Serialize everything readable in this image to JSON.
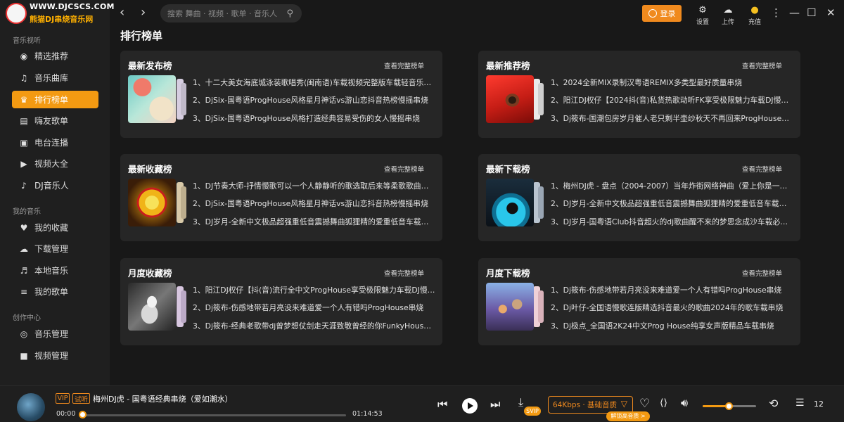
{
  "app": {
    "url": "WWW.DJCSCS.COM",
    "brand": "熊猫DJ串烧音乐网"
  },
  "sidebar": {
    "sections": [
      {
        "title": "音乐视听",
        "items": [
          {
            "label": "精选推荐",
            "icon": "recommend-icon"
          },
          {
            "label": "音乐曲库",
            "icon": "music-note-icon"
          },
          {
            "label": "排行榜单",
            "icon": "medal-icon",
            "active": true
          },
          {
            "label": "嗨友歌单",
            "icon": "playlist-icon"
          },
          {
            "label": "电台连播",
            "icon": "radio-icon"
          },
          {
            "label": "视频大全",
            "icon": "video-icon"
          },
          {
            "label": "DJ音乐人",
            "icon": "dj-person-icon"
          }
        ]
      },
      {
        "title": "我的音乐",
        "items": [
          {
            "label": "我的收藏",
            "icon": "heart-icon"
          },
          {
            "label": "下载管理",
            "icon": "cloud-download-icon"
          },
          {
            "label": "本地音乐",
            "icon": "local-music-icon"
          },
          {
            "label": "我的歌单",
            "icon": "my-playlist-icon"
          }
        ]
      },
      {
        "title": "创作中心",
        "items": [
          {
            "label": "音乐管理",
            "icon": "music-manage-icon"
          },
          {
            "label": "视频管理",
            "icon": "video-manage-icon"
          }
        ]
      }
    ]
  },
  "topbar": {
    "search_placeholder": "搜索 舞曲 · 视频 · 歌单 · 音乐人",
    "login": "登录",
    "settings": "设置",
    "upload": "上传",
    "recharge": "充值"
  },
  "main": {
    "title": "排行榜单",
    "more_label": "查看完整榜单",
    "cards": [
      {
        "title": "最新发布榜",
        "items": [
          "1、十二大美女海底城泳装歌唱秀(闽南语)车载视频完整版车载轻音乐CD碟",
          "2、DjSix-国粤语ProgHouse风格星月神话vs游山恋抖音热榜慢摇串烧",
          "3、DjSix-国粤语ProgHouse风格打造经典容易受伤的女人慢摇串烧"
        ]
      },
      {
        "title": "最新推荐榜",
        "items": [
          "1、2024全新MIX录制汉粤语REMIX多类型最好质量串烧",
          "2、阳江DJ权仔【2024抖(音)私货热歌动听FK享受极限魅力车载DJ慢摇大碟",
          "3、Dj筱布-国潮包房岁月催人老只剩半壶纱秋天不再回来ProgHouse专辑"
        ]
      },
      {
        "title": "最新收藏榜",
        "items": [
          "1、DJ节奏大师-抒情慢歌可以一个人静静听的歌选取后来等柔歌歌曲连版",
          "2、DjSix-国粤语ProgHouse风格星月神话vs游山恋抖音热榜慢摇串烧",
          "3、DJ岁月-全新中文极品超强重低音震撼舞曲狐狸精的爱重低音车载大碟"
        ]
      },
      {
        "title": "最新下载榜",
        "items": [
          "1、梅州DJ虎 - 盘点（2004-2007）当年炸街网络神曲（爱上你是一个错）",
          "2、DJ岁月-全新中文极品超强重低音震撼舞曲狐狸精的爱重低音车载大碟",
          "3、DJ岁月-国粤语Club抖音超火的dj歌曲醒不来的梦思念成沙车载必备大碟"
        ]
      },
      {
        "title": "月度收藏榜",
        "items": [
          "1、阳江DJ权仔【抖(音)流行全中文ProgHouse享受极限魅力车载DJ慢摇大碟",
          "2、Dj筱布-伤感地带若月亮没来难道爱一个人有错吗ProgHouse串烧",
          "3、Dj筱布-经典老歌带dj曾梦想仗剑走天涯致敬曾经的你FunkyHouse专辑"
        ]
      },
      {
        "title": "月度下载榜",
        "items": [
          "1、Dj筱布-伤感地带若月亮没来难道爱一个人有错吗ProgHouse串烧",
          "2、Dj叶仔-全国语慢歌连版精选抖音最火的歌曲2024年的歌车载串烧",
          "3、Dj极点_全国语2K24中文Prog House纯享女声版精品车载串烧"
        ]
      }
    ]
  },
  "player": {
    "vip": "VIP",
    "trial": "试听",
    "song": "梅州DJ虎 - 国粤语经典串烧（爱如潮水）",
    "current": "00:00",
    "duration": "01:14:53",
    "progress": 0,
    "quality": "64Kbps · 基础音质",
    "svip": "SVIP",
    "hq_badge": "解锁高音质 >",
    "volume": 0.5,
    "playlist_count": "12",
    "accent": "#f39a12"
  }
}
